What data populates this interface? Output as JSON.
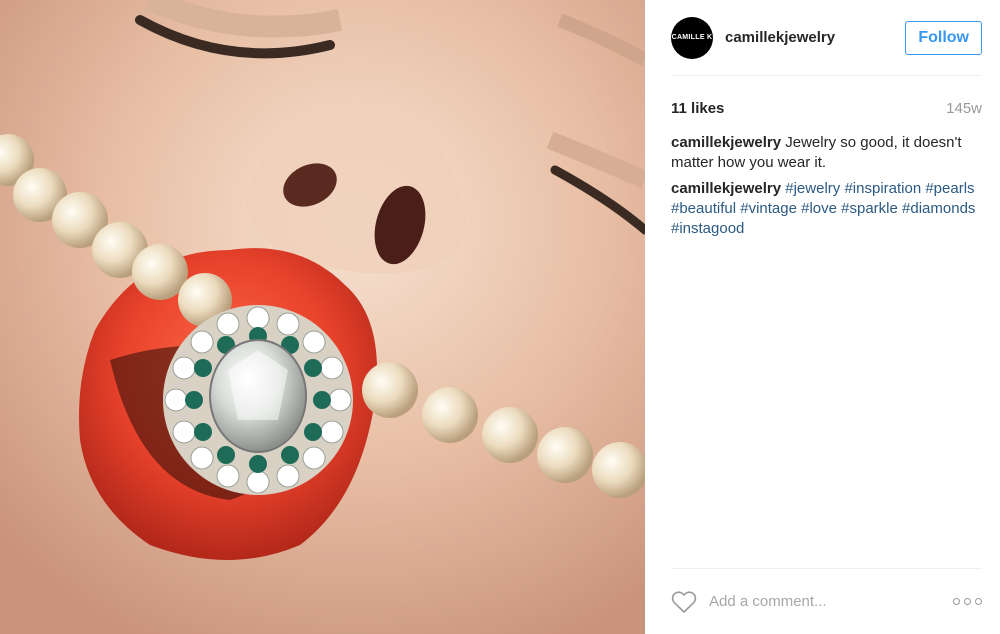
{
  "post": {
    "avatar_text": "CAMILLE K",
    "username": "camillekjewelry",
    "follow_label": "Follow",
    "likes": "11 likes",
    "time": "145w",
    "caption": {
      "username": "camillekjewelry",
      "text": "Jewelry so good, it doesn't matter how you wear it."
    },
    "comment": {
      "username": "camillekjewelry",
      "hashtags": [
        "#jewelry",
        "#inspiration",
        "#pearls",
        "#beautiful",
        "#vintage",
        "#love",
        "#sparkle",
        "#diamonds",
        "#instagood"
      ]
    },
    "comment_placeholder": "Add a comment...",
    "icons": {
      "like": "heart-icon",
      "more": "more-options-icon"
    },
    "colors": {
      "accent": "#3897f0",
      "hashtag": "#2b5a83",
      "muted": "#999999",
      "lips": "#e8422b"
    }
  }
}
